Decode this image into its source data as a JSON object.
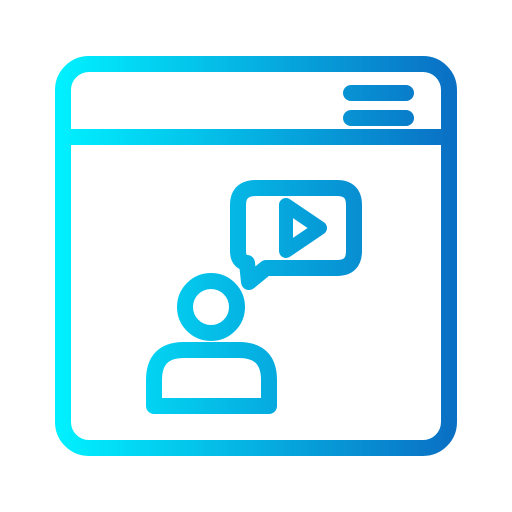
{
  "icon": {
    "name": "video-call-browser-icon",
    "colors": {
      "gradient_start": "#00F0FF",
      "gradient_end": "#0A70C4",
      "background": "#FFFFFF"
    },
    "parts": [
      "browser-window-icon",
      "menu-icon",
      "speech-bubble-icon",
      "play-icon",
      "user-icon"
    ]
  }
}
